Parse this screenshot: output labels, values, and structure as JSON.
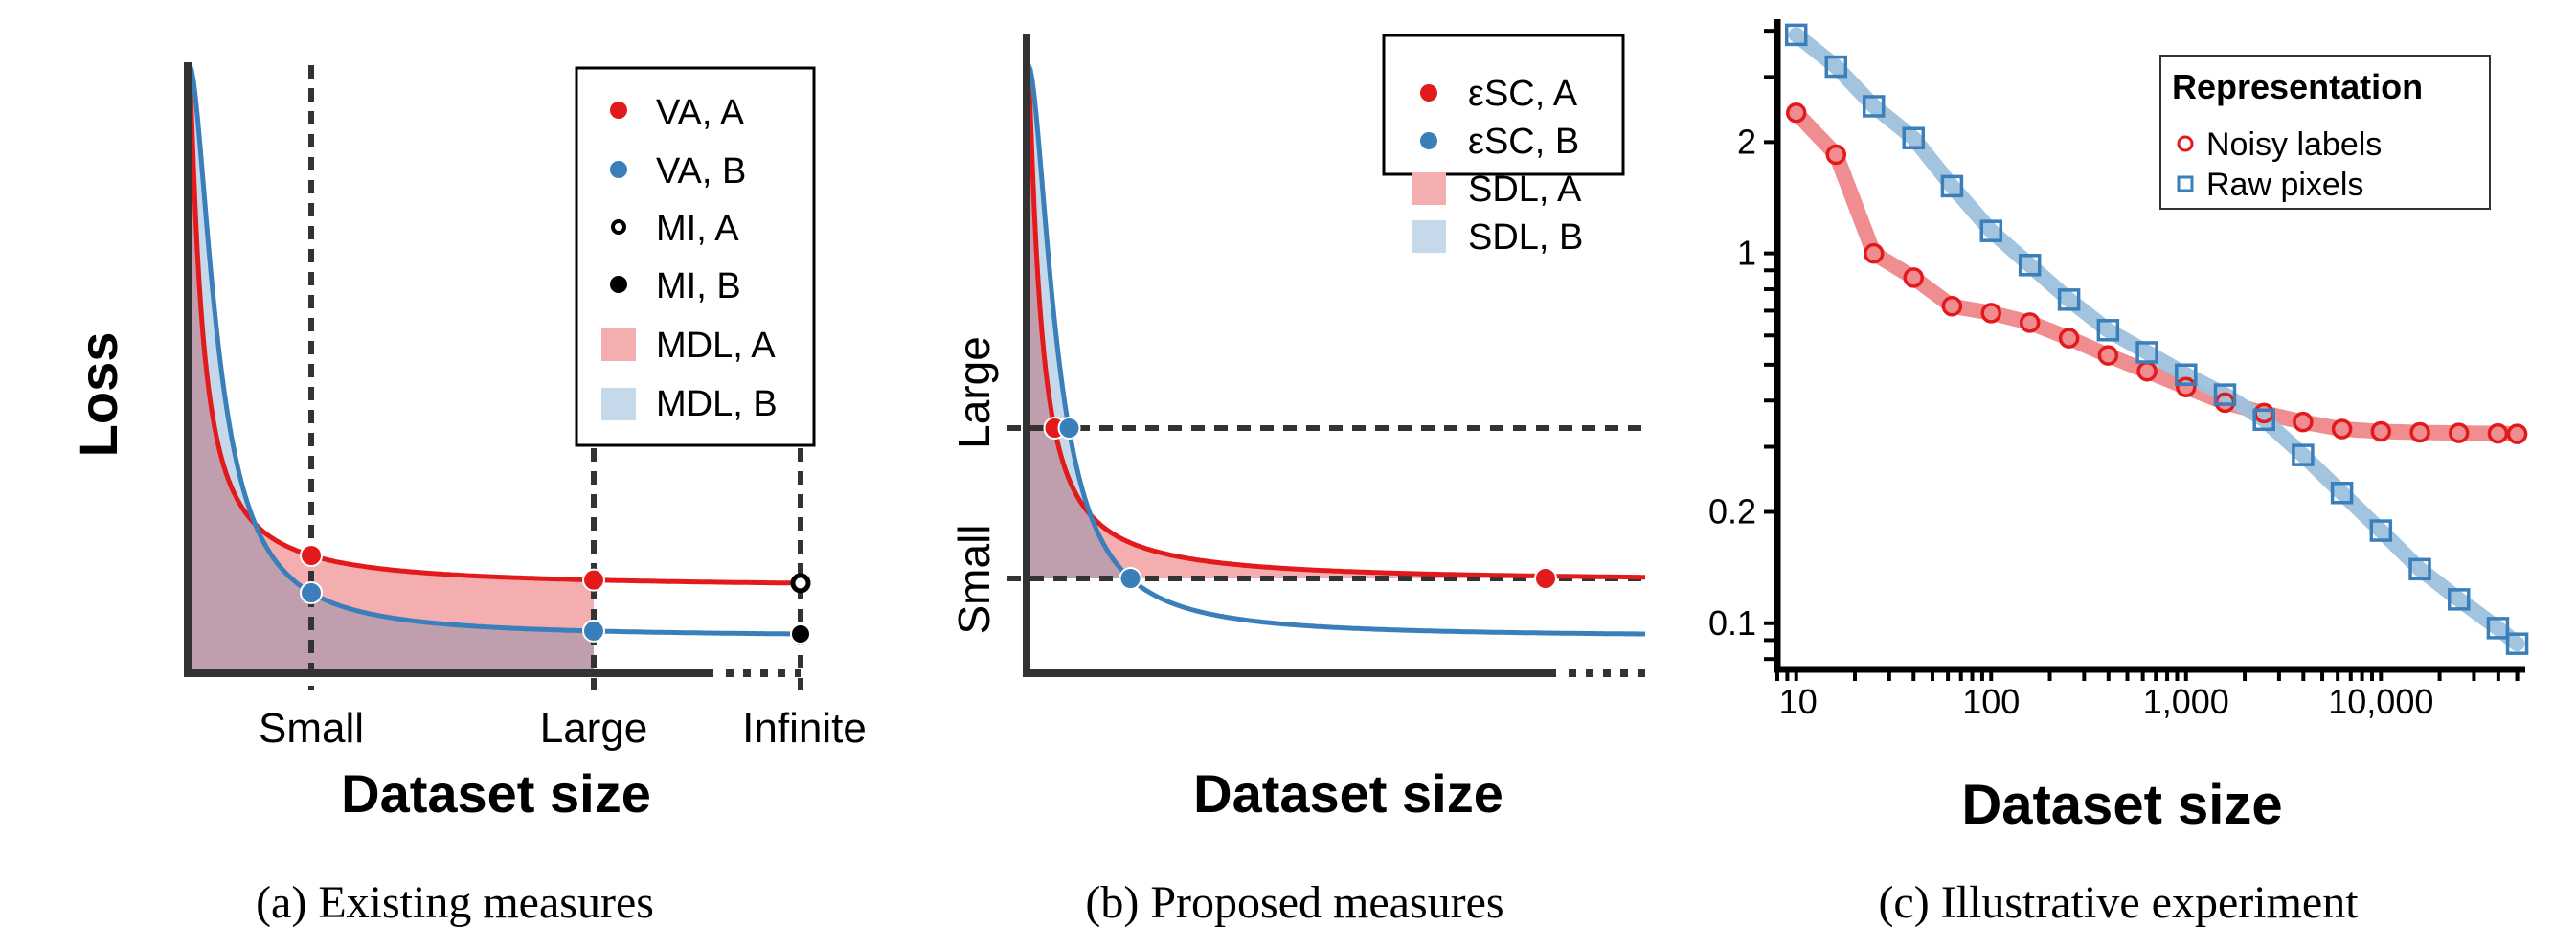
{
  "figure": {
    "captions": [
      "(a) Existing measures",
      "(b) Proposed measures",
      "(c) Illustrative experiment"
    ]
  },
  "colors": {
    "red": "#e31a1c",
    "blue": "#3a7fba",
    "red_fill": "#f4aeb0",
    "blue_fill": "#c6d9ea",
    "overlap_fill": "#bf9fae",
    "axis": "#333333",
    "red_line_c": "#f08d90",
    "blue_line_c": "#9ec1dc"
  },
  "chart_data": [
    {
      "type": "area",
      "panel": "a",
      "caption": "(a) Existing measures",
      "ylabel": "Loss",
      "xlabel": "Dataset size",
      "x_ticks": [
        "Small",
        "Large",
        "Infinite"
      ],
      "legend": {
        "placement": "top-right",
        "entries": [
          {
            "label": "VA, A",
            "marker": "filled-circle",
            "color": "#e31a1c"
          },
          {
            "label": "VA, B",
            "marker": "filled-circle",
            "color": "#3a7fba"
          },
          {
            "label": "MI, A",
            "marker": "open-circle",
            "color": "#000000"
          },
          {
            "label": "MI, B",
            "marker": "filled-circle",
            "color": "#000000"
          },
          {
            "label": "MDL, A",
            "marker": "square-fill",
            "color": "#f4aeb0"
          },
          {
            "label": "MDL, B",
            "marker": "square-fill",
            "color": "#c6d9ea"
          }
        ]
      },
      "series": [
        {
          "name": "A",
          "description": "loss curve for representation A (red), decays quickly then plateaus higher",
          "asymptote": 0.14
        },
        {
          "name": "B",
          "description": "loss curve for representation B (blue), starts higher, crosses A near small, plateaus lower",
          "asymptote": 0.06
        }
      ],
      "markers": [
        {
          "label": "VA, A",
          "at": "Small"
        },
        {
          "label": "VA, B",
          "at": "Small"
        },
        {
          "label": "VA, A",
          "at": "Large"
        },
        {
          "label": "VA, B",
          "at": "Large"
        },
        {
          "label": "MI, A",
          "at": "Infinite"
        },
        {
          "label": "MI, B",
          "at": "Infinite"
        }
      ]
    },
    {
      "type": "area",
      "panel": "b",
      "caption": "(b) Proposed measures",
      "xlabel": "Dataset size",
      "y_ticks": [
        "Small",
        "Large"
      ],
      "legend": {
        "placement": "top-right",
        "entries": [
          {
            "label": "εSC, A",
            "marker": "filled-circle",
            "color": "#e31a1c"
          },
          {
            "label": "εSC, B",
            "marker": "filled-circle",
            "color": "#3a7fba"
          },
          {
            "label": "SDL, A",
            "marker": "square-fill",
            "color": "#f4aeb0"
          },
          {
            "label": "SDL, B",
            "marker": "square-fill",
            "color": "#c6d9ea"
          }
        ]
      },
      "series": [
        {
          "name": "A",
          "asymptote": 0.15
        },
        {
          "name": "B",
          "asymptote": 0.06
        }
      ],
      "thresholds": [
        "Large",
        "Small"
      ],
      "markers": [
        {
          "label": "εSC, A",
          "at_threshold": "Large"
        },
        {
          "label": "εSC, B",
          "at_threshold": "Large"
        },
        {
          "label": "εSC, B",
          "at_threshold": "Small"
        },
        {
          "label": "εSC, A",
          "at_threshold": "Small"
        }
      ]
    },
    {
      "type": "line",
      "panel": "c",
      "caption": "(c) Illustrative experiment",
      "title": "",
      "xlabel": "Dataset size",
      "ylabel": "",
      "xscale": "log",
      "yscale": "log",
      "xlim": [
        8,
        55000
      ],
      "ylim": [
        0.075,
        4.3
      ],
      "x_ticks": [
        {
          "value": 10,
          "label": "10"
        },
        {
          "value": 100,
          "label": "100"
        },
        {
          "value": 1000,
          "label": "1,000"
        },
        {
          "value": 10000,
          "label": "10,000"
        }
      ],
      "y_ticks": [
        {
          "value": 0.1,
          "label": "0.1"
        },
        {
          "value": 0.2,
          "label": "0.2"
        },
        {
          "value": 1,
          "label": "1"
        },
        {
          "value": 2,
          "label": "2"
        }
      ],
      "grid": false,
      "legend": {
        "title": "Representation",
        "placement": "top-right",
        "entries": [
          "Noisy labels",
          "Raw pixels"
        ]
      },
      "x": [
        10,
        16,
        25,
        40,
        63,
        100,
        158,
        251,
        398,
        631,
        1000,
        1585,
        2512,
        3981,
        6310,
        10000,
        15849,
        25119,
        39811,
        50000
      ],
      "series": [
        {
          "name": "Noisy labels",
          "marker": "circle",
          "color": "#e31a1c",
          "values": [
            2.4,
            1.85,
            1.0,
            0.86,
            0.72,
            0.69,
            0.65,
            0.59,
            0.53,
            0.48,
            0.435,
            0.395,
            0.37,
            0.35,
            0.335,
            0.33,
            0.328,
            0.327,
            0.326,
            0.325
          ]
        },
        {
          "name": "Raw pixels",
          "marker": "square",
          "color": "#3a7fba",
          "values": [
            3.9,
            3.2,
            2.5,
            2.05,
            1.52,
            1.15,
            0.93,
            0.75,
            0.62,
            0.54,
            0.47,
            0.415,
            0.355,
            0.285,
            0.225,
            0.178,
            0.14,
            0.116,
            0.097,
            0.088
          ]
        }
      ]
    }
  ],
  "panel_a": {
    "ylabel": "Loss",
    "xlabel": "Dataset size",
    "tick_small": "Small",
    "tick_large": "Large",
    "tick_infinite": "Infinite",
    "legend": [
      "VA, A",
      "VA, B",
      "MI, A",
      "MI, B",
      "MDL, A",
      "MDL, B"
    ]
  },
  "panel_b": {
    "ylabel_small": "Small",
    "ylabel_large": "Large",
    "xlabel": "Dataset size",
    "legend": [
      "εSC, A",
      "εSC, B",
      "SDL, A",
      "SDL, B"
    ]
  },
  "panel_c": {
    "xlabel": "Dataset size",
    "legend_title": "Representation",
    "legend": [
      "Noisy labels",
      "Raw pixels"
    ]
  }
}
